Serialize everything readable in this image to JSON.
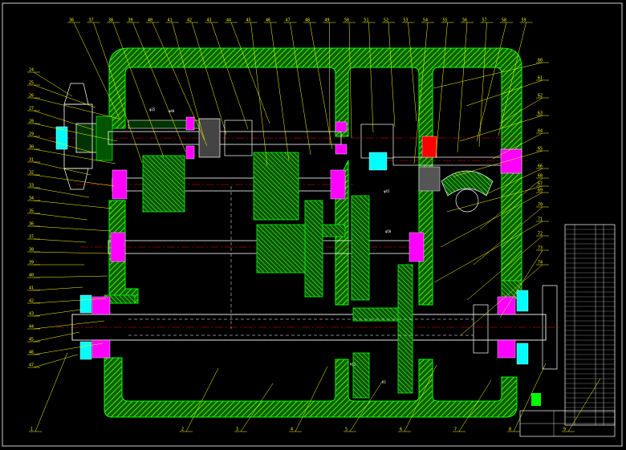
{
  "drawing": {
    "colors": {
      "background": "#000000",
      "housing": "#00cc00",
      "housing_hatch": "#7fff00",
      "leader": "#ffff00",
      "centerline": "#ff0000",
      "hidden": "#ffffff",
      "bearing": "#ff00ff",
      "seal": "#00ffff",
      "outline": "#ffffff"
    },
    "top_balloons": [
      "36",
      "37",
      "38",
      "39",
      "40",
      "41",
      "42",
      "43",
      "44",
      "45",
      "46",
      "47",
      "48",
      "49",
      "50",
      "51",
      "52",
      "53",
      "54",
      "55",
      "56",
      "57",
      "58",
      "59"
    ],
    "left_balloons": [
      "24",
      "25",
      "26",
      "27",
      "28",
      "29",
      "30",
      "31",
      "32",
      "33",
      "34",
      "35",
      "36",
      "37",
      "38",
      "39",
      "40",
      "41",
      "42",
      "43",
      "44",
      "45",
      "46",
      "47"
    ],
    "right_balloons": [
      "60",
      "61",
      "62",
      "63",
      "64",
      "65",
      "66",
      "67",
      "68",
      "69",
      "70",
      "71",
      "72",
      "73",
      "74"
    ],
    "bottom_balloons": [
      "1",
      "2",
      "3",
      "4",
      "5",
      "6",
      "7",
      "8",
      "9"
    ],
    "dim_notes": [
      "φ35",
      "φ40",
      "φ45",
      "φ50",
      "M12",
      "R5"
    ]
  }
}
